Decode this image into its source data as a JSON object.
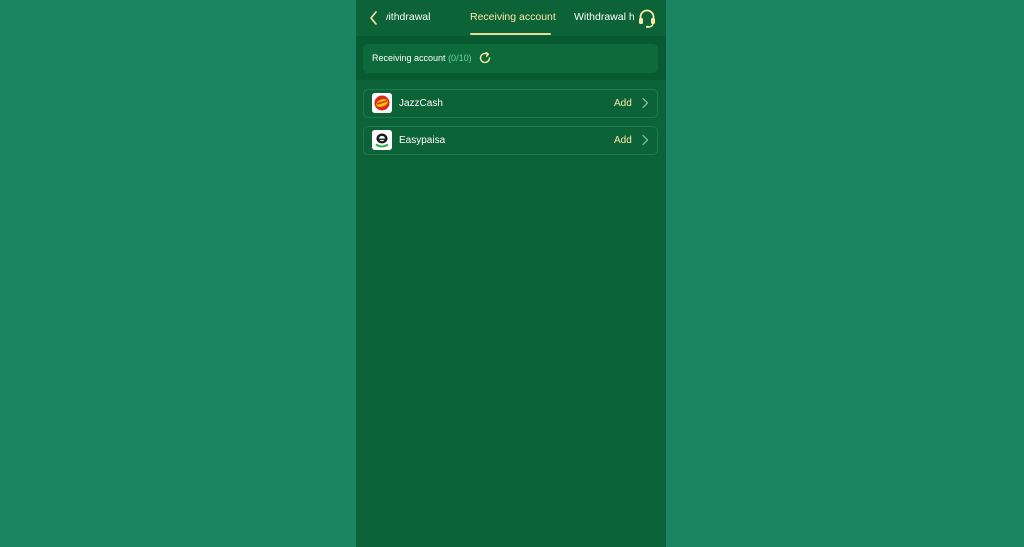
{
  "header": {
    "tabs": [
      {
        "label": "Account withdrawal"
      },
      {
        "label": "Receiving account"
      },
      {
        "label": "Withdrawal history"
      }
    ],
    "active_tab_index": 1
  },
  "summary": {
    "title": "Receiving account",
    "count": "(0/10)"
  },
  "accounts": [
    {
      "name": "JazzCash",
      "action": "Add",
      "icon": "jazzcash-logo"
    },
    {
      "name": "Easypaisa",
      "action": "Add",
      "icon": "easypaisa-logo"
    }
  ],
  "colors": {
    "background": "#1b8561",
    "panel": "#0b6337",
    "accent": "#ffe9a3",
    "count": "#6fd3a1"
  }
}
